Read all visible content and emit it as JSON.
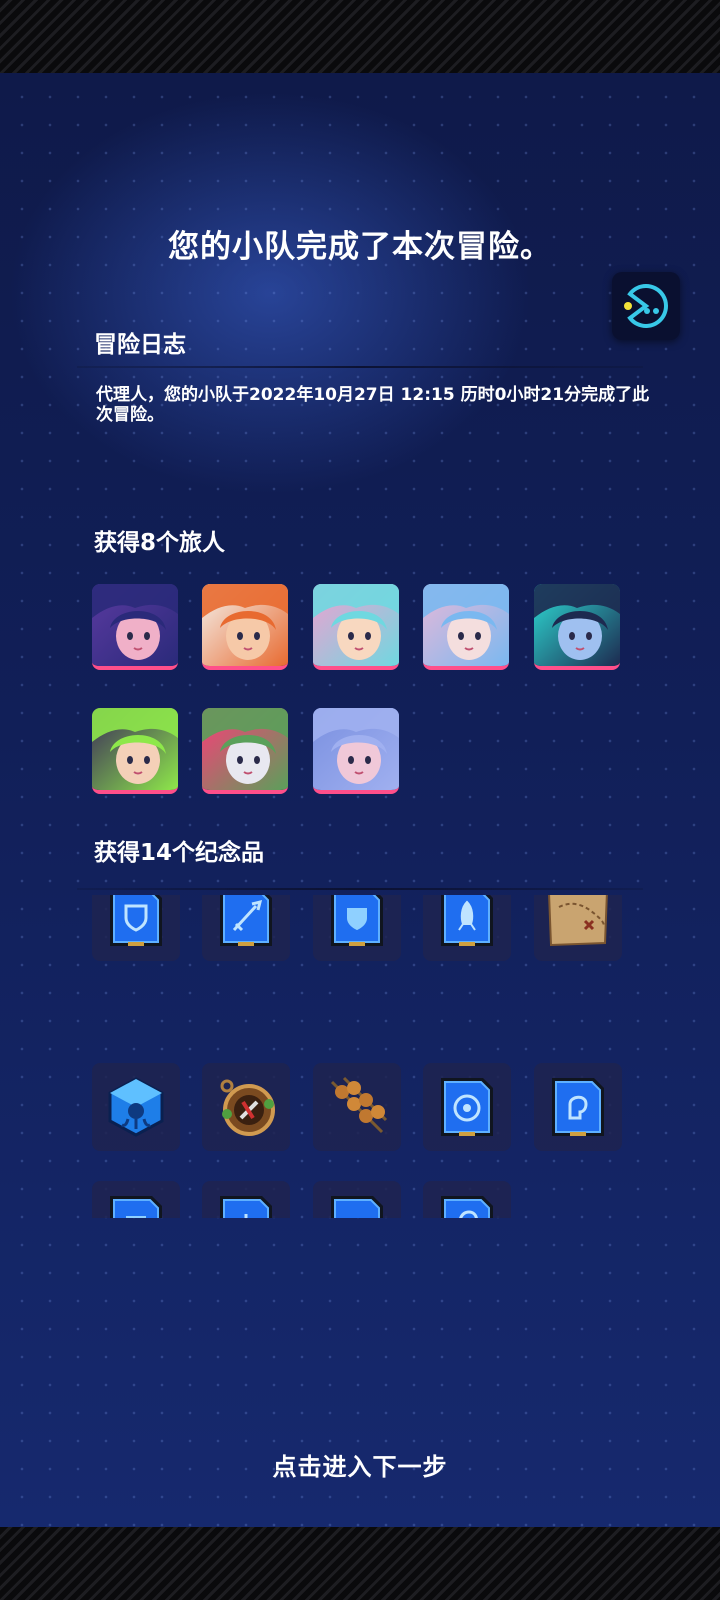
{
  "header": {
    "title": "您的小队完成了本次冒险。"
  },
  "log": {
    "heading": "冒险日志",
    "text": "代理人，您的小队于2022年10月27日 12:15 历时0小时21分完成了此次冒险。"
  },
  "travelers": {
    "heading": "获得8个旅人",
    "items": [
      {
        "name": "traveler-purple-hair",
        "colors": [
          "#2a2a7a",
          "#5a3aa0",
          "#f0b0c8"
        ]
      },
      {
        "name": "traveler-orange-hair-glasses",
        "colors": [
          "#e86a30",
          "#f4f4f0",
          "#f6c9a8"
        ]
      },
      {
        "name": "traveler-teal-hair-goggles",
        "colors": [
          "#6fd8e0",
          "#f0a0d0",
          "#f8d8c0"
        ]
      },
      {
        "name": "traveler-blue-hair-mask",
        "colors": [
          "#7ab8f0",
          "#e8b8d8",
          "#f4dede"
        ]
      },
      {
        "name": "traveler-robot-helmet",
        "colors": [
          "#1d2a50",
          "#2ee0d8",
          "#9fc0f0"
        ]
      },
      {
        "name": "traveler-green-hair",
        "colors": [
          "#8ee84a",
          "#3a2a5a",
          "#f4d0b8"
        ]
      },
      {
        "name": "traveler-green-skin-pink-hair",
        "colors": [
          "#5aa05a",
          "#ff3a7a",
          "#e8e8f0"
        ]
      },
      {
        "name": "traveler-lavender-hair-sleeping",
        "colors": [
          "#a0b0f0",
          "#7a90e0",
          "#f0c8d8"
        ]
      }
    ],
    "accent_color": "#ff4f8a"
  },
  "souvenirs": {
    "heading": "获得14个纪念品",
    "items": [
      {
        "name": "card-shield-crest-icon",
        "kind": "card"
      },
      {
        "name": "card-sword-icon",
        "kind": "card"
      },
      {
        "name": "card-shield-icon",
        "kind": "card"
      },
      {
        "name": "card-rocket-icon",
        "kind": "card"
      },
      {
        "name": "treasure-map-icon",
        "kind": "map"
      },
      {
        "name": "blue-octopus-cube-icon",
        "kind": "cube"
      },
      {
        "name": "bronze-compass-medal-icon",
        "kind": "medal"
      },
      {
        "name": "meatball-skewers-icon",
        "kind": "food"
      },
      {
        "name": "card-circle-emblem-icon",
        "kind": "card"
      },
      {
        "name": "card-head-profile-icon",
        "kind": "card"
      },
      {
        "name": "card-shield-icon",
        "kind": "card"
      },
      {
        "name": "card-robot-icon",
        "kind": "card"
      },
      {
        "name": "card-trumpet-icon",
        "kind": "card"
      },
      {
        "name": "card-ear-icon",
        "kind": "card"
      }
    ]
  },
  "footer": {
    "next_label": "点击进入下一步"
  },
  "colors": {
    "background_top": "#0f1a4a",
    "background_bottom": "#16296e",
    "text": "#ffffff",
    "card_blue": "#1f6ef0",
    "bot_icon": "#38c8e8"
  }
}
